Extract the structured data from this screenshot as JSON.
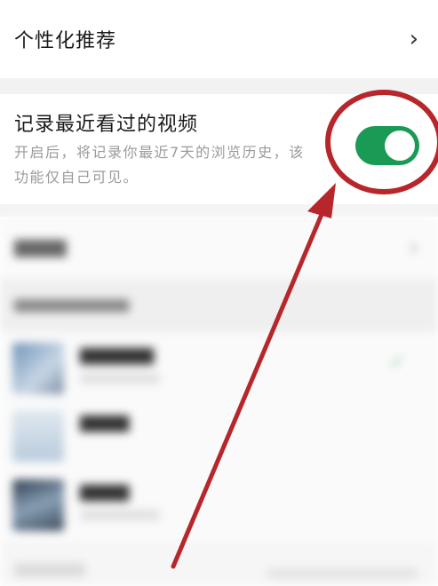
{
  "personalized": {
    "label": "个性化推荐",
    "chevron_icon": "chevron-right-icon"
  },
  "history": {
    "title": "记录最近看过的视频",
    "description": "开启后，将记录你最近7天的浏览历史，该功能仅自己可见。",
    "toggle_on": true,
    "toggle_color": "#1a9b55"
  },
  "annotation": {
    "color": "#b7262a"
  }
}
